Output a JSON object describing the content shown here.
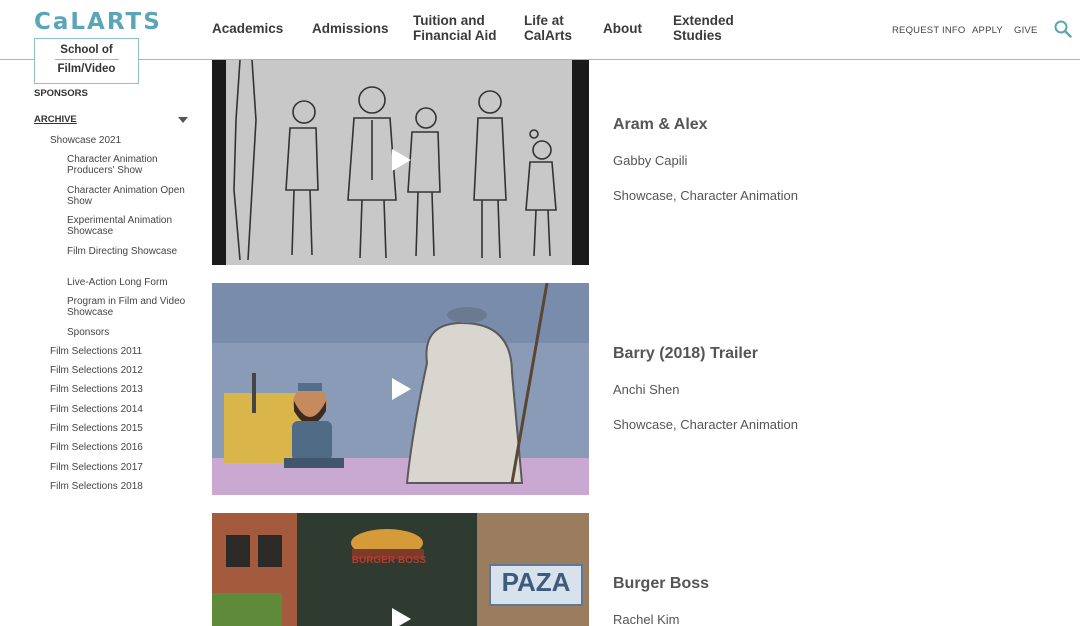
{
  "header": {
    "logo": "CaLARTS",
    "school_line1": "School of",
    "school_line2": "Film/Video",
    "nav": [
      {
        "label": "Academics"
      },
      {
        "label": "Admissions"
      },
      {
        "label": "Tuition and\nFinancial Aid"
      },
      {
        "label": "Life at\nCalArts"
      },
      {
        "label": "About"
      },
      {
        "label": "Extended\nStudies"
      }
    ],
    "utility": [
      "REQUEST INFO",
      "APPLY",
      "GIVE"
    ],
    "search_icon": "search-icon",
    "accent_color": "#5aa5b8"
  },
  "sidebar": {
    "sponsors": "SPONSORS",
    "archive": "ARCHIVE",
    "showcase_2021": "Showcase 2021",
    "showcase_children": [
      "Character Animation Producers' Show",
      "Character Animation Open Show",
      "Experimental Animation Showcase",
      "Film Directing Showcase",
      "Live-Action Long Form",
      "Program in Film and Video Showcase",
      "Sponsors"
    ],
    "film_selections": [
      "Film Selections 2011",
      "Film Selections 2012",
      "Film Selections 2013",
      "Film Selections 2014",
      "Film Selections 2015",
      "Film Selections 2016",
      "Film Selections 2017",
      "Film Selections 2018"
    ]
  },
  "items": [
    {
      "title": "Aram & Alex",
      "author": "Gabby Capili",
      "category": "Showcase, Character Animation"
    },
    {
      "title": "Barry (2018) Trailer",
      "author": "Anchi Shen",
      "category": "Showcase, Character Animation"
    },
    {
      "title": "Burger Boss",
      "author": "Rachel Kim",
      "category": ""
    }
  ],
  "thumb3_signs": {
    "left": "BURGER BOSS",
    "right": "PAZA"
  }
}
